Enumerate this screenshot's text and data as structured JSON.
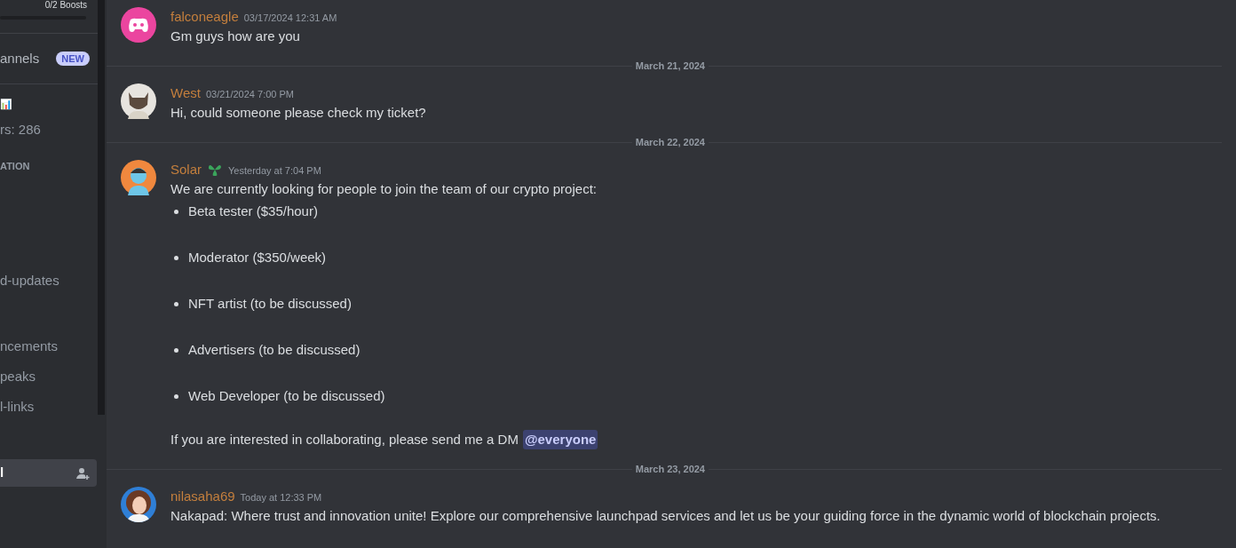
{
  "sidebar": {
    "boosts": "0/2 Boosts",
    "items": [
      {
        "kind": "channel",
        "label": "annels",
        "badge": "NEW",
        "selected": false
      },
      {
        "kind": "emoji",
        "label": "📊"
      },
      {
        "kind": "channel",
        "label": "rs: 286",
        "selected": false
      },
      {
        "kind": "header",
        "label": "ATION"
      },
      {
        "kind": "channel",
        "label": "d-updates",
        "selected": false
      },
      {
        "kind": "channel",
        "label": "ncements",
        "selected": false
      },
      {
        "kind": "channel",
        "label": "peaks",
        "selected": false
      },
      {
        "kind": "channel",
        "label": "l-links",
        "selected": false
      },
      {
        "kind": "voice",
        "label": "l",
        "selected": true
      }
    ]
  },
  "messages": [
    {
      "kind": "message",
      "avatar": {
        "kind": "logo"
      },
      "author": "falconeagle",
      "time": "03/17/2024 12:31 AM",
      "lines": [
        {
          "kind": "text",
          "text": "Gm guys how are you"
        }
      ]
    },
    {
      "kind": "divider",
      "date": "March 21, 2024"
    },
    {
      "kind": "message",
      "avatar": {
        "kind": "animal"
      },
      "author": "West",
      "time": "03/21/2024 7:00 PM",
      "lines": [
        {
          "kind": "text",
          "text": "Hi, could someone please check my ticket?"
        }
      ]
    },
    {
      "kind": "divider",
      "date": "March 22, 2024"
    },
    {
      "kind": "message",
      "avatar": {
        "kind": "figure"
      },
      "author": "Solar",
      "badge": true,
      "time": "Yesterday at 7:04 PM",
      "lines": [
        {
          "kind": "text",
          "text": "We are currently looking for people to join the team of our crypto project:"
        },
        {
          "kind": "bullet",
          "text": "Beta tester ($35/hour)"
        },
        {
          "kind": "bullet",
          "text": "Moderator ($350/week)"
        },
        {
          "kind": "bullet",
          "text": "NFT artist (to be discussed)"
        },
        {
          "kind": "bullet",
          "text": "Advertisers (to be discussed)"
        },
        {
          "kind": "bullet",
          "text": "Web Developer (to be discussed)"
        },
        {
          "kind": "text",
          "text": "If you are interested in collaborating, please send me a DM",
          "mention": "@everyone"
        }
      ]
    },
    {
      "kind": "divider",
      "date": "March 23, 2024"
    },
    {
      "kind": "message",
      "author": "nilasaha69",
      "time": "Today at 12:33 PM",
      "lines": [
        {
          "kind": "text",
          "text": "Nakapad: Where trust and innovation unite! Explore our comprehensive launchpad services and let us be your guiding force in the dynamic world of blockchain projects."
        }
      ]
    }
  ]
}
